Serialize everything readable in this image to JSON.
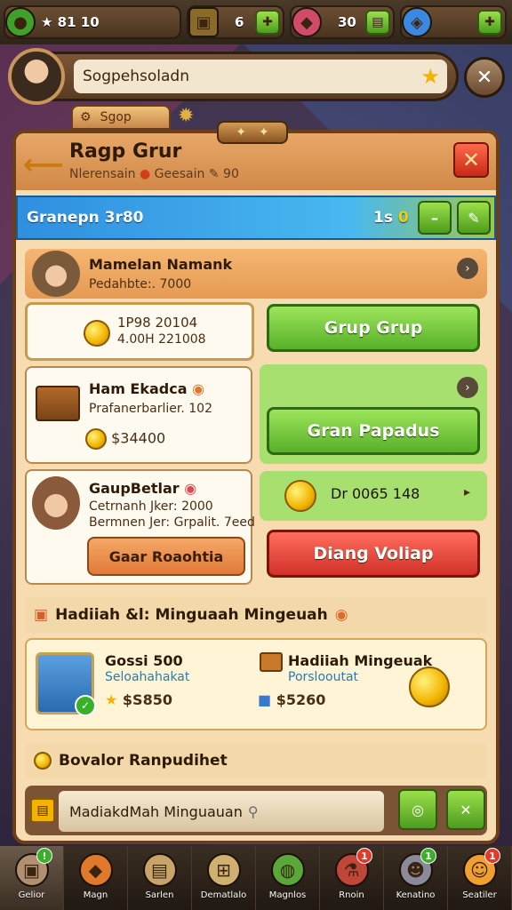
{
  "resources": [
    {
      "icon": "green-gem-icon",
      "value": "★ 81 10",
      "color": "#3fa02a"
    },
    {
      "icon": "chest-icon",
      "value": "6",
      "color": "#8a6a2a"
    },
    {
      "icon": "cake-icon",
      "value": "30",
      "color": "#d04a6a"
    },
    {
      "icon": "blue-gem-icon",
      "value": "",
      "color": "#3a88e0"
    }
  ],
  "profile": {
    "name": "Sogpehsoladn"
  },
  "shop_tab": {
    "label": "Sgop"
  },
  "header": {
    "title": "Ragp Grur",
    "subtitle": "Nlerensain",
    "subtitle2": "Geesain",
    "subtitle3": "90"
  },
  "bluebar": {
    "label": "Granepn 3r80",
    "count": "1s",
    "count2": "0"
  },
  "selected_member": {
    "name": "Mamelan Namank",
    "sub": "Pedahbte:. 7000"
  },
  "coin_box": {
    "line1": "1P98 20104",
    "line2": "4.00H 221008"
  },
  "buttons": {
    "group": "Grup Grup",
    "gran": "Gran Papadus",
    "diang": "Diang Voliap",
    "gaar": "Gaar Roaohtia"
  },
  "card2": {
    "name": "Ham Ekadca",
    "sub": "Prafanerbarlier. 102",
    "price": "$34400"
  },
  "card3": {
    "name": "GaupBetlar",
    "sub1": "Cetrnanh Jker: 2000",
    "sub2": "Bermnen Jer: Grpalit. 7eed"
  },
  "dr_box": {
    "label": "Dr 0065 148"
  },
  "weekly": {
    "title": "Hadiiah &l: Minguaah Mingeuah"
  },
  "reward1": {
    "name": "Gossi 500",
    "sub": "Seloahahakat",
    "price": "$S850"
  },
  "reward2": {
    "name": "Hadiiah Mingeuak",
    "sub": "Porslooutat",
    "price": "$5260"
  },
  "bonus": {
    "title": "Bovalor Ranpudihet"
  },
  "input": {
    "value": "MadiakdMah Minguauan"
  },
  "nav": [
    {
      "label": "Gelior",
      "icon": "chest-icon",
      "color": "#b09070",
      "badge": "!",
      "badge_color": "#3ab02a"
    },
    {
      "label": "Magn",
      "icon": "shield-icon",
      "color": "#e07a2a"
    },
    {
      "label": "Sarlen",
      "icon": "scroll-icon",
      "color": "#c8a46a"
    },
    {
      "label": "Dematlalo",
      "icon": "map-icon",
      "color": "#d0b070"
    },
    {
      "label": "Magnlos",
      "icon": "globe-icon",
      "color": "#5aa83a"
    },
    {
      "label": "Rnoin",
      "icon": "potion-icon",
      "color": "#c0463a",
      "badge": "1",
      "badge_color": "#e03a2a"
    },
    {
      "label": "Kenatino",
      "icon": "mask-icon",
      "color": "#8a8a9a",
      "badge": "1",
      "badge_color": "#3ab02a"
    },
    {
      "label": "Seatiler",
      "icon": "smiley-icon",
      "color": "#f0a030",
      "badge": "1",
      "badge_color": "#e03a2a"
    }
  ]
}
